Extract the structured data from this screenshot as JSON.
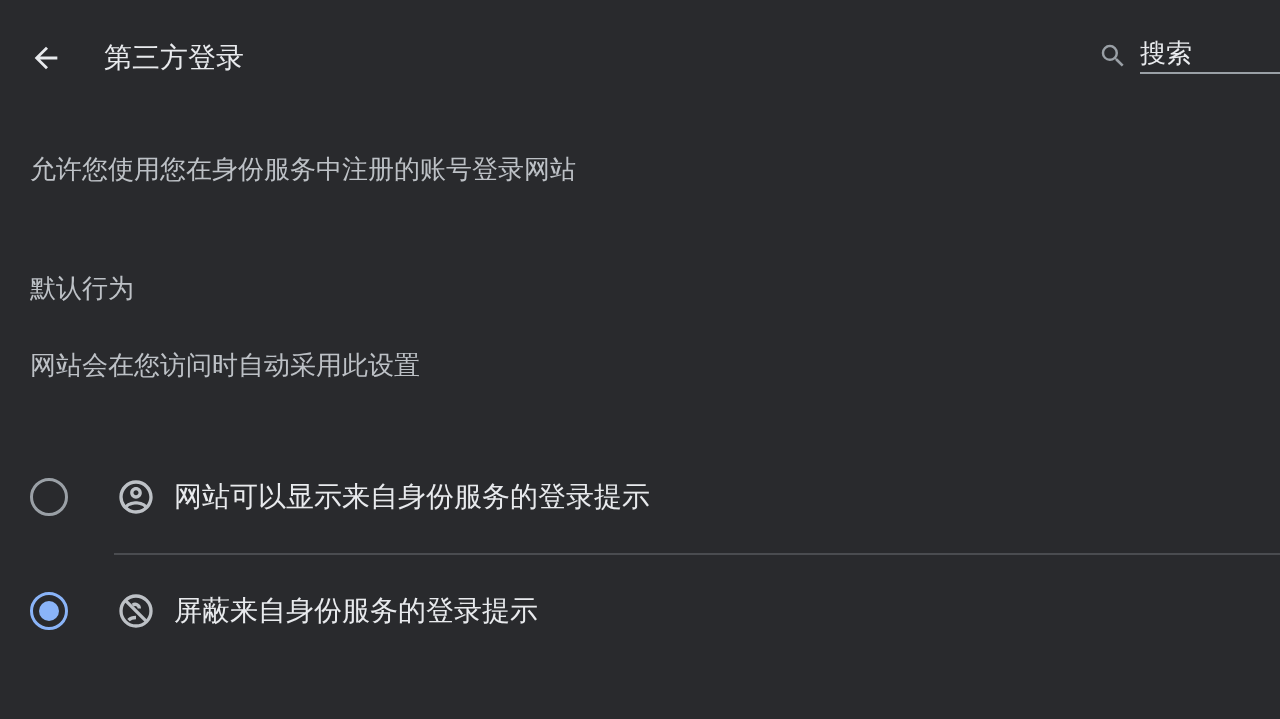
{
  "header": {
    "title": "第三方登录",
    "search": {
      "placeholder": "搜索"
    }
  },
  "description": "允许您使用您在身份服务中注册的账号登录网站",
  "section": {
    "title": "默认行为",
    "subtitle": "网站会在您访问时自动采用此设置"
  },
  "options": [
    {
      "kind": "allow",
      "label": "网站可以显示来自身份服务的登录提示",
      "selected": false
    },
    {
      "kind": "block",
      "label": "屏蔽来自身份服务的登录提示",
      "selected": true
    }
  ]
}
